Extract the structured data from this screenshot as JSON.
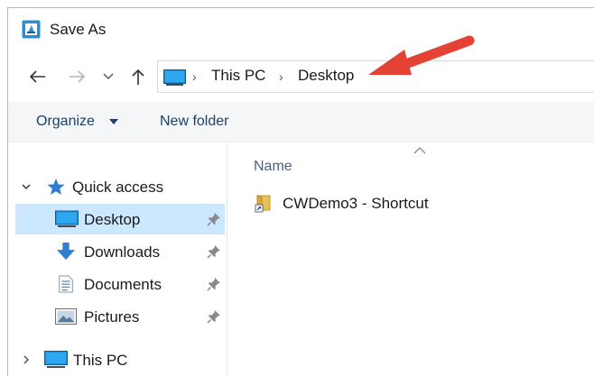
{
  "window": {
    "title": "Save As",
    "app_icon": "save-as-app-icon"
  },
  "navigation": {
    "back_icon": "arrow-left-icon",
    "forward_icon": "arrow-right-icon",
    "recent_icon": "chevron-down-icon",
    "up_icon": "arrow-up-icon"
  },
  "address_bar": {
    "location_icon": "this-pc-icon",
    "breadcrumbs": [
      "This PC",
      "Desktop"
    ]
  },
  "command_bar": {
    "organize_label": "Organize",
    "new_folder_label": "New folder"
  },
  "nav_pane": {
    "quick_access": {
      "label": "Quick access",
      "expanded": true,
      "icon": "star-icon"
    },
    "items": [
      {
        "label": "Desktop",
        "icon": "desktop-icon",
        "pinned": true,
        "selected": true
      },
      {
        "label": "Downloads",
        "icon": "download-arrow-icon",
        "pinned": true,
        "selected": false
      },
      {
        "label": "Documents",
        "icon": "document-icon",
        "pinned": true,
        "selected": false
      },
      {
        "label": "Pictures",
        "icon": "pictures-icon",
        "pinned": true,
        "selected": false
      }
    ],
    "this_pc": {
      "label": "This PC",
      "expanded": false,
      "icon": "computer-icon"
    }
  },
  "content": {
    "column_header": "Name",
    "sort": "ascending",
    "files": [
      {
        "name": "CWDemo3 - Shortcut",
        "icon": "folder-shortcut-icon"
      }
    ]
  },
  "colors": {
    "selection": "#cce8ff",
    "command_bar_bg": "#f5f6f7",
    "annotation_arrow": "#e34234",
    "folder_yellow": "#e8c05a",
    "link_text": "#1f3f6a"
  }
}
